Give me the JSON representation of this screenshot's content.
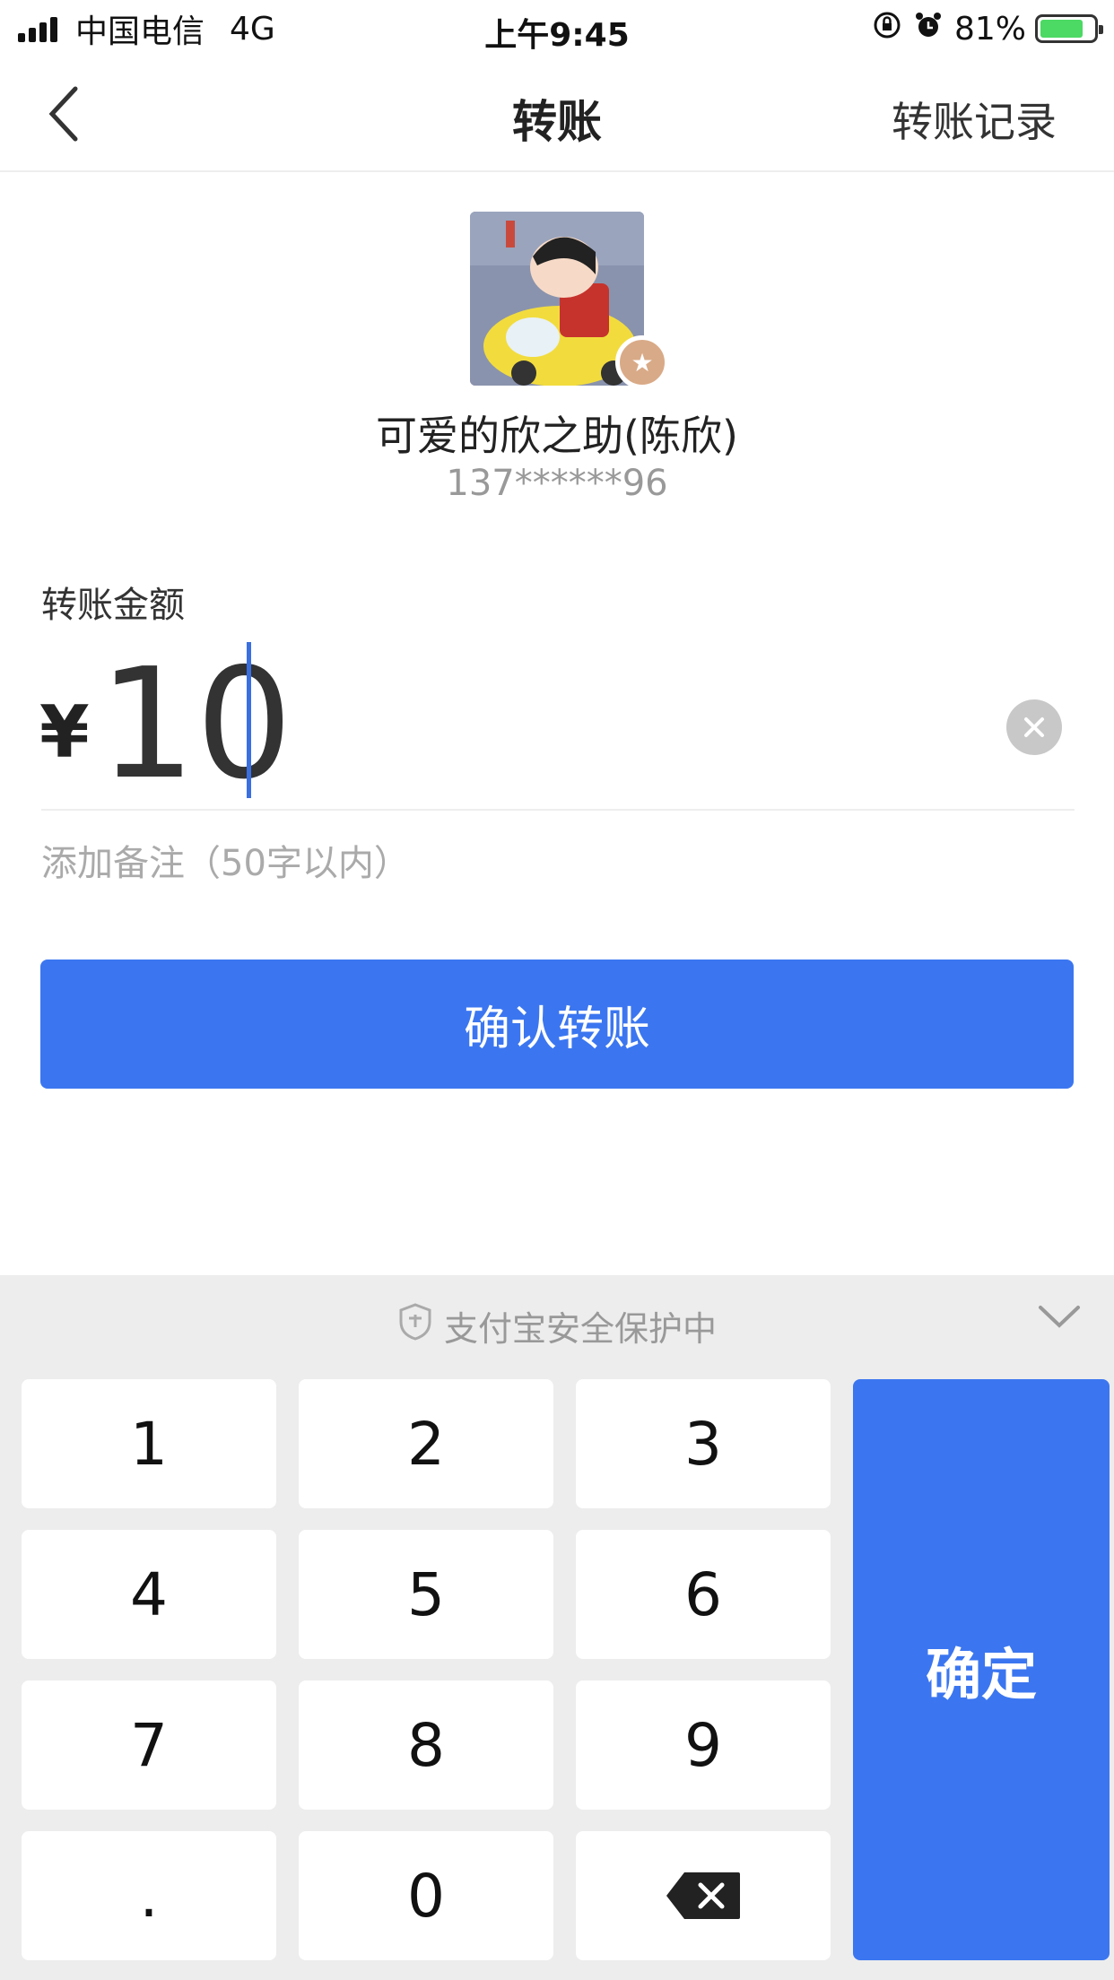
{
  "status_bar": {
    "carrier": "中国电信",
    "network": "4G",
    "time": "上午9:45",
    "battery_percent": "81%",
    "battery_level": 0.81
  },
  "nav": {
    "title": "转账",
    "right_link": "转账记录"
  },
  "payee": {
    "name": "可爱的欣之助(陈欣)",
    "phone": "137******96"
  },
  "amount": {
    "label": "转账金额",
    "currency_symbol": "¥",
    "value": "10"
  },
  "remark": {
    "placeholder": "添加备注（50字以内）"
  },
  "confirm_button": "确认转账",
  "keyboard": {
    "security_text": "支付宝安全保护中",
    "keys": [
      "1",
      "2",
      "3",
      "4",
      "5",
      "6",
      "7",
      "8",
      "9",
      ".",
      "0"
    ],
    "confirm_label": "确定"
  },
  "colors": {
    "accent": "#3b76f0",
    "keyboard_bg": "#ededed"
  }
}
